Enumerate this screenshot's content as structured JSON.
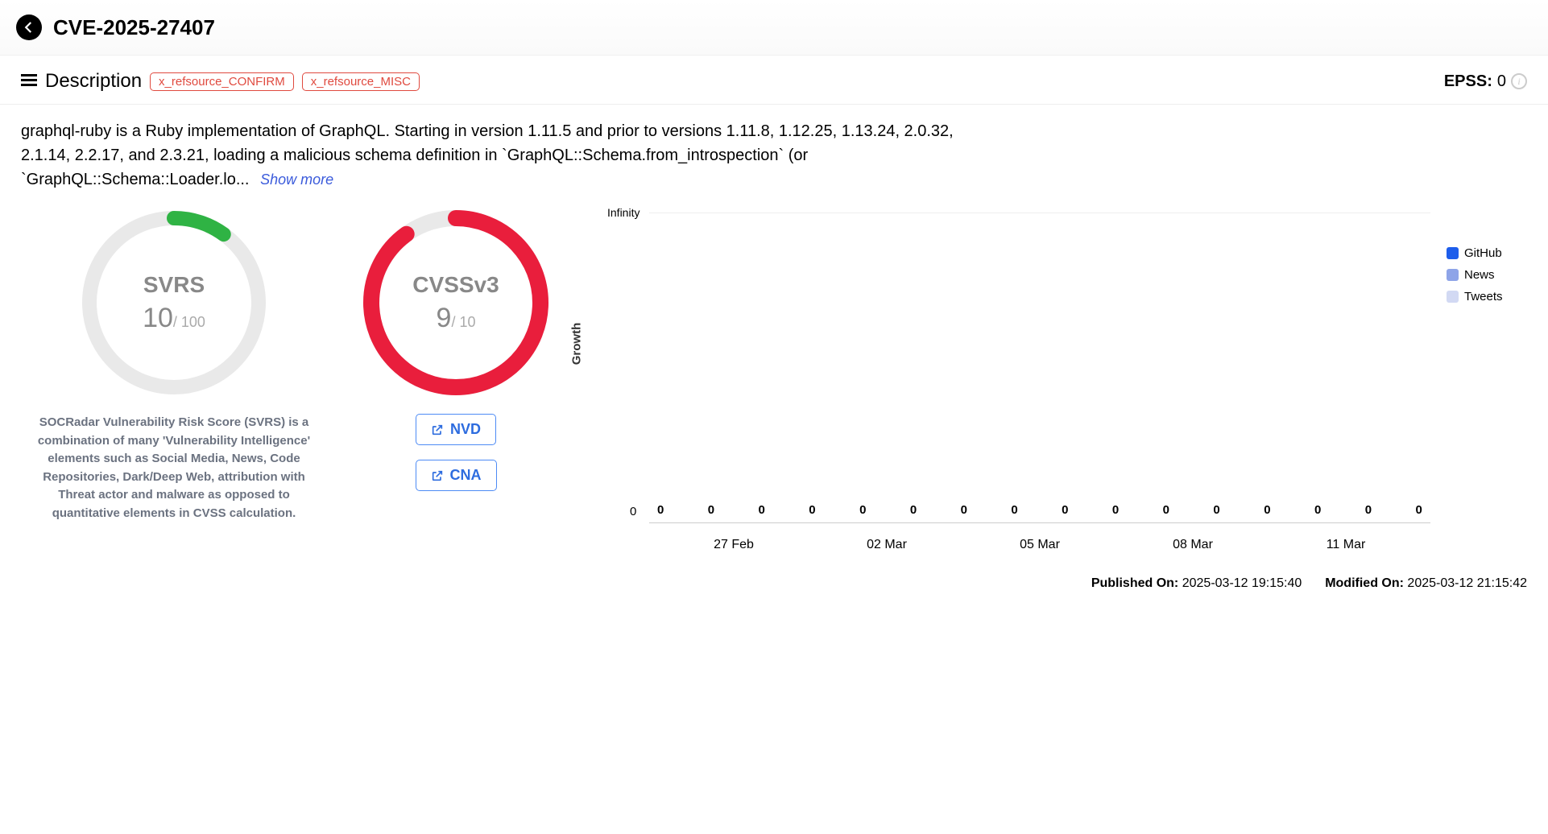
{
  "header": {
    "title": "CVE-2025-27407"
  },
  "description": {
    "heading": "Description",
    "tags": [
      "x_refsource_CONFIRM",
      "x_refsource_MISC"
    ],
    "epss_label": "EPSS:",
    "epss_value": "0",
    "text": "graphql-ruby is a Ruby implementation of GraphQL. Starting in version 1.11.5 and prior to versions 1.11.8, 1.12.25, 1.13.24, 2.0.32, 2.1.14, 2.2.17, and 2.3.21, loading a malicious schema definition in `GraphQL::Schema.from_introspection` (or `GraphQL::Schema::Loader.lo...",
    "show_more": "Show more"
  },
  "svrs": {
    "label": "SVRS",
    "score": "10",
    "max": "/ 100",
    "percent": 10,
    "color": "#2fb344",
    "desc": "SOCRadar Vulnerability Risk Score (SVRS) is a combination of many 'Vulnerability Intelligence' elements such as Social Media, News, Code Repositories, Dark/Deep Web, attribution with Threat actor and malware as opposed to quantitative elements in CVSS calculation."
  },
  "cvss": {
    "label": "CVSSv3",
    "score": "9",
    "max": "/ 10",
    "percent": 90,
    "color": "#e91e3c",
    "links": [
      "NVD",
      "CNA"
    ]
  },
  "chart_data": {
    "type": "line",
    "title": "",
    "ylabel": "Growth",
    "xlabel": "",
    "ylim": [
      "0",
      "Infinity"
    ],
    "categories": [
      "27 Feb",
      "02 Mar",
      "05 Mar",
      "08 Mar",
      "11 Mar"
    ],
    "point_labels": [
      "0",
      "0",
      "0",
      "0",
      "0",
      "0",
      "0",
      "0",
      "0",
      "0",
      "0",
      "0",
      "0",
      "0",
      "0",
      "0"
    ],
    "series": [
      {
        "name": "GitHub",
        "color": "#1d5deb",
        "values": [
          0,
          0,
          0,
          0,
          0,
          0,
          0,
          0,
          0,
          0,
          0,
          0,
          0,
          0,
          0,
          0
        ]
      },
      {
        "name": "News",
        "color": "#8ea4e8",
        "values": [
          0,
          0,
          0,
          0,
          0,
          0,
          0,
          0,
          0,
          0,
          0,
          0,
          0,
          0,
          0,
          0
        ]
      },
      {
        "name": "Tweets",
        "color": "#d2d9f3",
        "values": [
          0,
          0,
          0,
          0,
          0,
          0,
          0,
          0,
          0,
          0,
          0,
          0,
          0,
          0,
          0,
          0
        ]
      }
    ]
  },
  "dates": {
    "published_label": "Published On:",
    "published_value": "2025-03-12 19:15:40",
    "modified_label": "Modified On:",
    "modified_value": "2025-03-12 21:15:42"
  }
}
